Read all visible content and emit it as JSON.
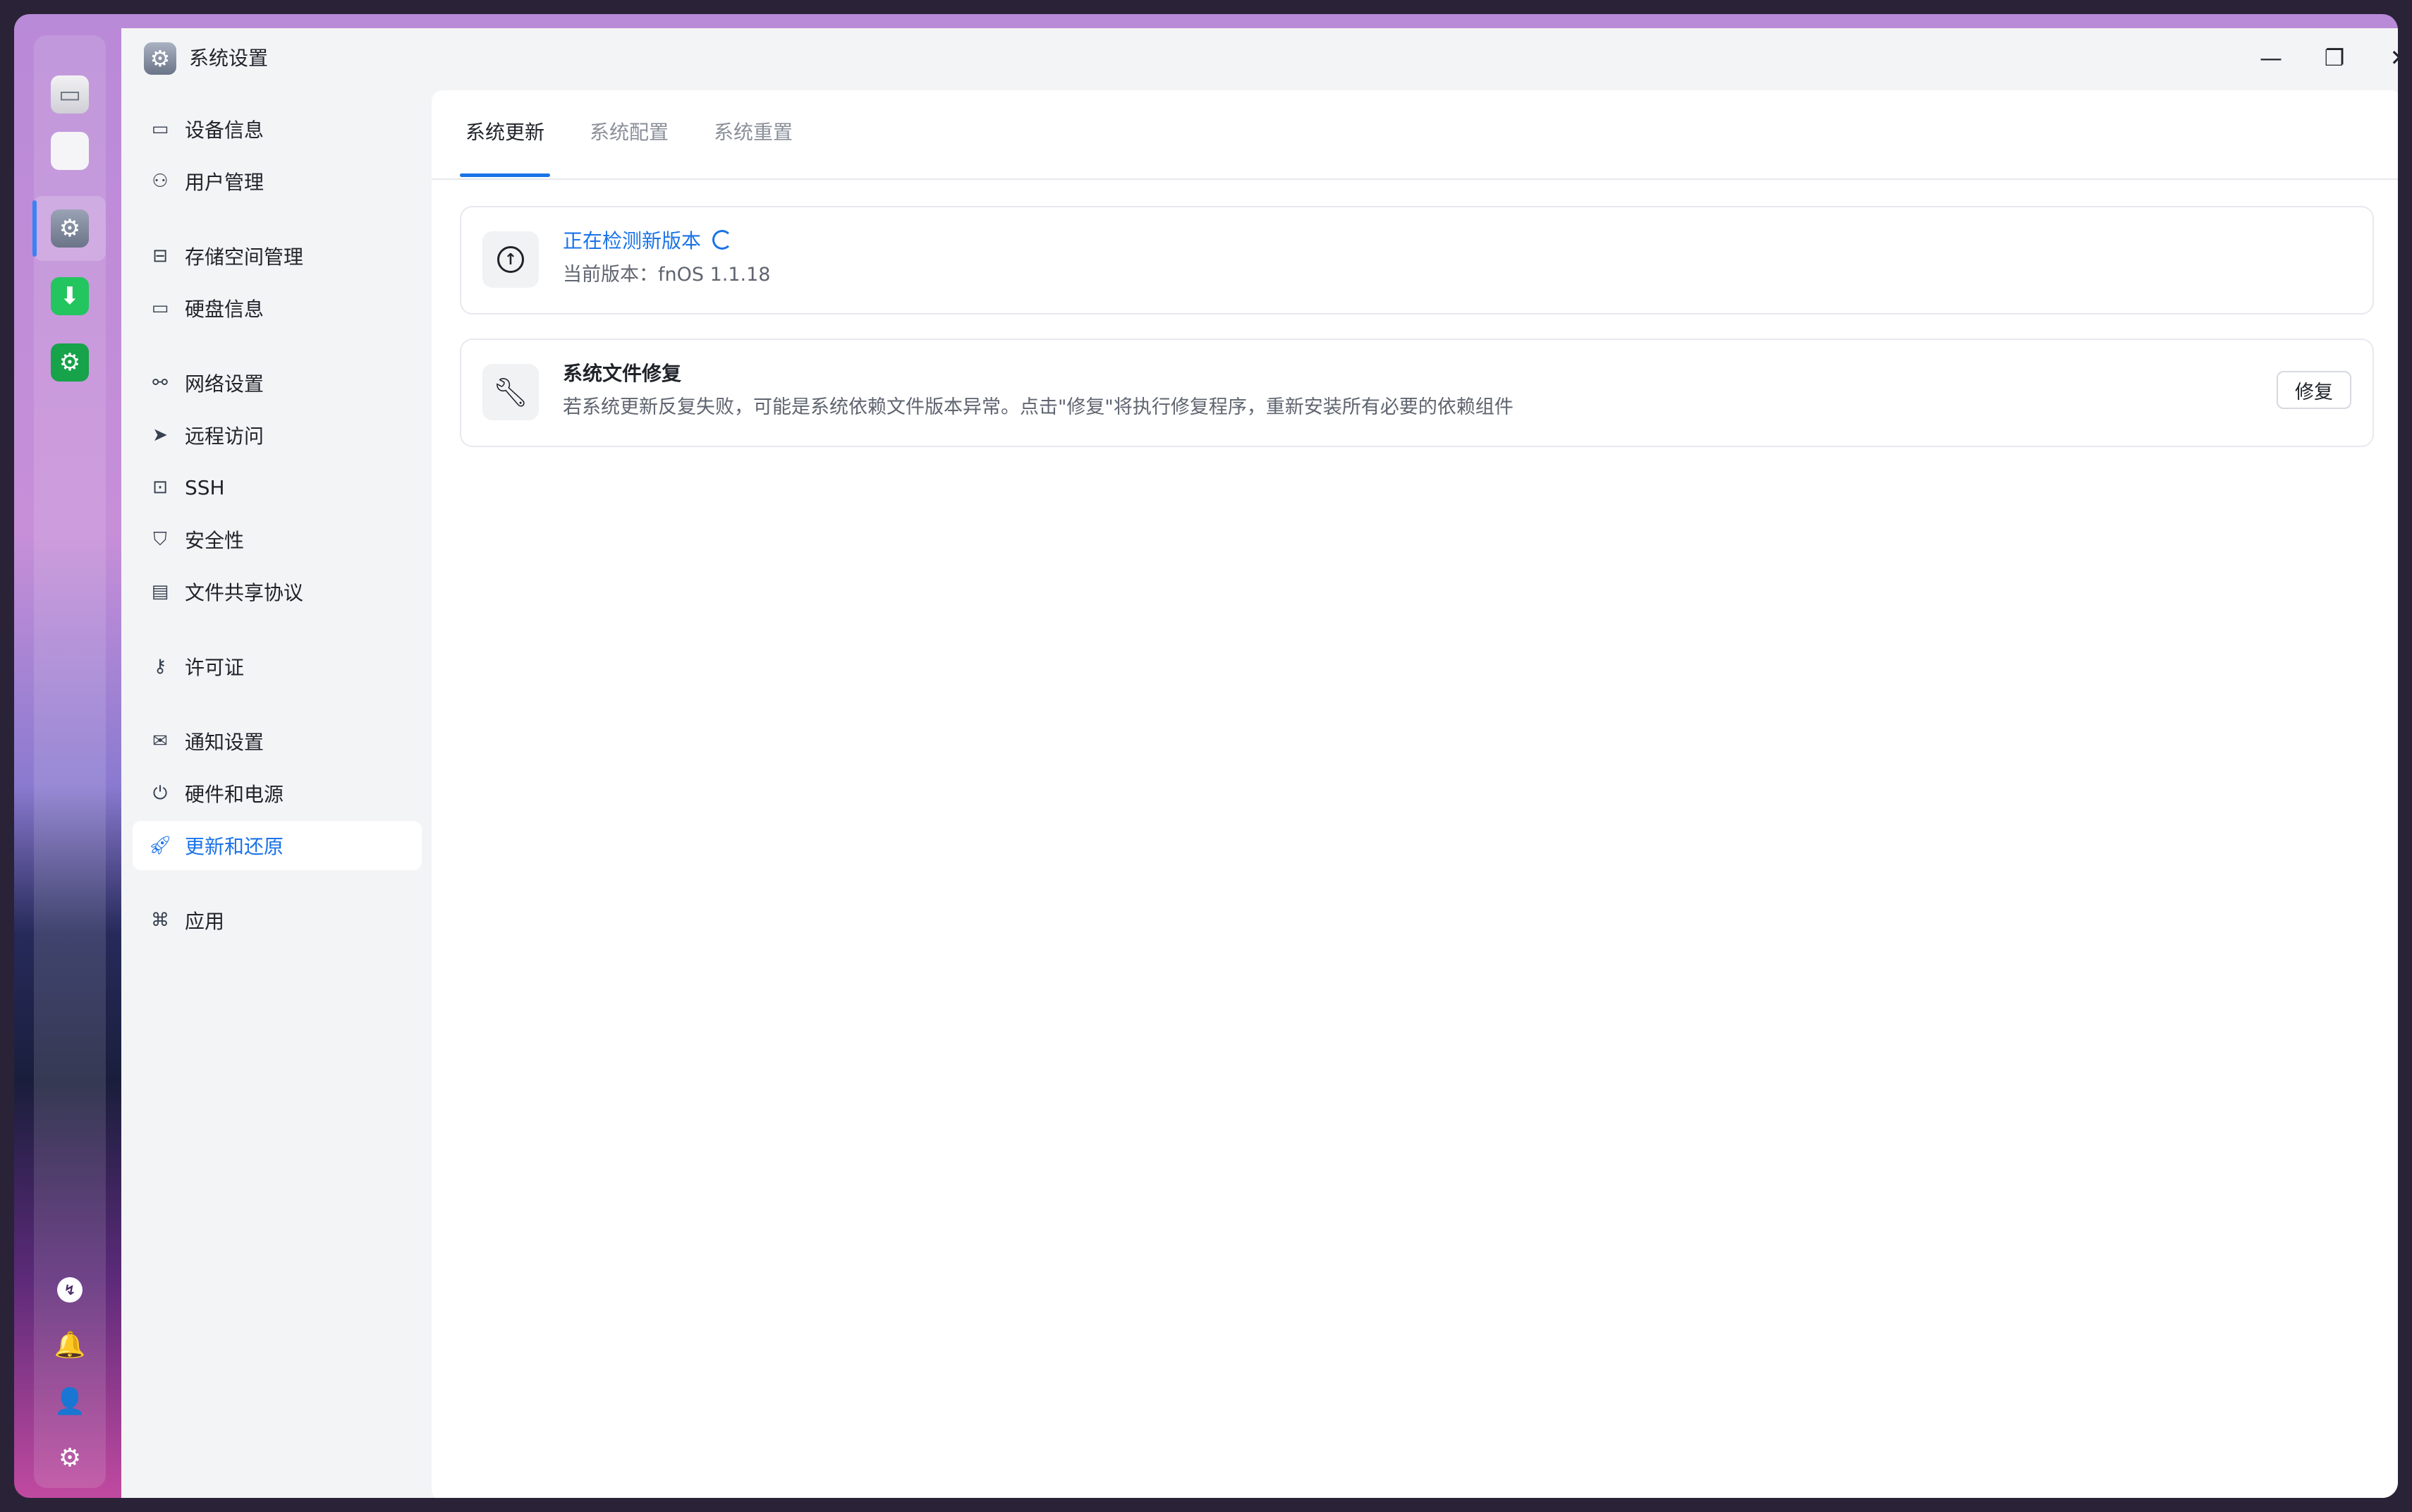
{
  "window": {
    "title": "系统设置",
    "controls": [
      "minimize-icon",
      "restore-icon",
      "close-icon"
    ]
  },
  "dock": {
    "apps": [
      {
        "name": "monitor",
        "icon": "monitor-icon"
      },
      {
        "name": "app-center",
        "icon": "app-grid-icon"
      },
      {
        "name": "system-settings",
        "icon": "gear-icon",
        "active": true
      },
      {
        "name": "download",
        "icon": "download-icon"
      },
      {
        "name": "green-app",
        "icon": "green-gear-icon"
      }
    ],
    "bottom": [
      "status-icon",
      "bell-icon",
      "user-icon",
      "settings-icon"
    ]
  },
  "nav": {
    "items": [
      {
        "label": "设备信息",
        "icon": "device-icon"
      },
      {
        "label": "用户管理",
        "icon": "user-icon"
      },
      {
        "label": "存储空间管理",
        "icon": "storage-icon"
      },
      {
        "label": "硬盘信息",
        "icon": "disk-icon"
      },
      {
        "label": "网络设置",
        "icon": "network-icon"
      },
      {
        "label": "远程访问",
        "icon": "send-icon"
      },
      {
        "label": "SSH",
        "icon": "ssh-icon"
      },
      {
        "label": "安全性",
        "icon": "shield-icon"
      },
      {
        "label": "文件共享协议",
        "icon": "file-icon"
      },
      {
        "label": "许可证",
        "icon": "key-icon"
      },
      {
        "label": "通知设置",
        "icon": "mail-icon"
      },
      {
        "label": "硬件和电源",
        "icon": "power-icon"
      },
      {
        "label": "更新和还原",
        "icon": "rocket-icon",
        "selected": true
      },
      {
        "label": "应用",
        "icon": "apps-icon"
      }
    ]
  },
  "tabs": [
    {
      "label": "系统更新",
      "active": true
    },
    {
      "label": "系统配置"
    },
    {
      "label": "系统重置"
    }
  ],
  "update_card": {
    "title": "正在检测新版本",
    "version_label": "当前版本：",
    "version": "fnOS 1.1.18"
  },
  "repair_card": {
    "title": "系统文件修复",
    "description": "若系统更新反复失败，可能是系统依赖文件版本异常。点击\"修复\"将执行修复程序，重新安装所有必要的依赖组件",
    "button": "修复"
  },
  "colors": {
    "accent": "#1a73e8",
    "selected_bg": "#ffffff",
    "content_bg": "#ffffff",
    "sidebar_bg": "#f3f4f6"
  }
}
